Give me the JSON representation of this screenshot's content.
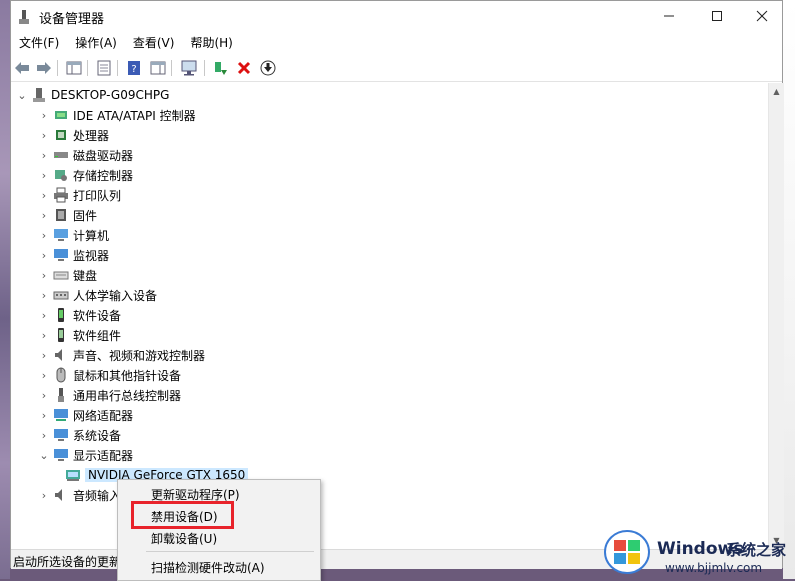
{
  "window": {
    "title": "设备管理器"
  },
  "menu": [
    "文件(F)",
    "操作(A)",
    "查看(V)",
    "帮助(H)"
  ],
  "tree": {
    "root": "DESKTOP-G09CHPG",
    "categories": [
      {
        "label": "IDE ATA/ATAPI 控制器",
        "icon": "ide-icon"
      },
      {
        "label": "处理器",
        "icon": "processor-icon"
      },
      {
        "label": "磁盘驱动器",
        "icon": "disk-icon"
      },
      {
        "label": "存储控制器",
        "icon": "storage-icon"
      },
      {
        "label": "打印队列",
        "icon": "printer-icon"
      },
      {
        "label": "固件",
        "icon": "firmware-icon"
      },
      {
        "label": "计算机",
        "icon": "computer-icon"
      },
      {
        "label": "监视器",
        "icon": "monitor-icon"
      },
      {
        "label": "键盘",
        "icon": "keyboard-icon"
      },
      {
        "label": "人体学输入设备",
        "icon": "hid-icon"
      },
      {
        "label": "软件设备",
        "icon": "software-device-icon"
      },
      {
        "label": "软件组件",
        "icon": "software-component-icon"
      },
      {
        "label": "声音、视频和游戏控制器",
        "icon": "sound-icon"
      },
      {
        "label": "鼠标和其他指针设备",
        "icon": "mouse-icon"
      },
      {
        "label": "通用串行总线控制器",
        "icon": "usb-icon"
      },
      {
        "label": "网络适配器",
        "icon": "network-icon"
      },
      {
        "label": "系统设备",
        "icon": "system-icon"
      },
      {
        "label": "显示适配器",
        "icon": "display-icon"
      }
    ],
    "gpu": "NVIDIA GeForce GTX 1650",
    "audio_partial": "音频输入"
  },
  "context_menu": {
    "update_driver": "更新驱动程序(P)",
    "disable": "禁用设备(D)",
    "uninstall": "卸载设备(U)",
    "scan": "扫描检测硬件改动(A)"
  },
  "status": "启动所选设备的更新",
  "watermark": {
    "title": "Windows",
    "subtitle": "系统之家",
    "url": "www.bjjmlv.com"
  },
  "colors": {
    "highlight": "#e8232b",
    "selection": "#cce8ff"
  }
}
